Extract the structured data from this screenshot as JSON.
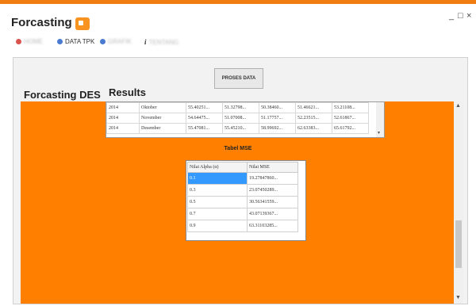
{
  "window": {
    "title": "Forcasting",
    "minimize": "_",
    "maximize": "□",
    "close": "×",
    "accent": "#f07c12"
  },
  "menu": {
    "items": [
      {
        "label": "HOME",
        "icon": "home-icon",
        "icon_color": "#d9534f",
        "blurred": true
      },
      {
        "label": "DATA TPK",
        "icon": "data-icon",
        "icon_color": "#4a7bd0",
        "blurred": false
      },
      {
        "label": "GRAFIK",
        "icon": "chart-icon",
        "icon_color": "#4a7bd0",
        "blurred": true
      },
      {
        "label": "TENTANG",
        "icon": "info-icon",
        "icon_color": "#333333",
        "blurred": true
      }
    ]
  },
  "toolbar": {
    "process_label": "PROSES DATA"
  },
  "labels": {
    "des": "Forcasting DES",
    "results": "Results"
  },
  "results": {
    "rows": [
      [
        "2014",
        "Oktober",
        "55.40251...",
        "51.32798...",
        "50.38460...",
        "51.46621...",
        "53.21108..."
      ],
      [
        "2014",
        "November",
        "54.64475...",
        "51.07008...",
        "51.17757...",
        "52.23515...",
        "52.61867..."
      ],
      [
        "2014",
        "Desember",
        "55.47081...",
        "55.45210...",
        "58.99692...",
        "62.63383...",
        "65.61792..."
      ]
    ]
  },
  "mse": {
    "title": "Tabel MSE",
    "headers": [
      "Nilai Alpha (α)",
      "Nilai MSE"
    ],
    "rows": [
      [
        "0.1",
        "19.27847860..."
      ],
      [
        "0.3",
        "23.07450289..."
      ],
      [
        "0.5",
        "30.56341559..."
      ],
      [
        "0.7",
        "43.07139367..."
      ],
      [
        "0.9",
        "63.31103285..."
      ]
    ],
    "selected_index": 0
  },
  "colors": {
    "panel": "#ff8000",
    "selection": "#3399ff"
  }
}
